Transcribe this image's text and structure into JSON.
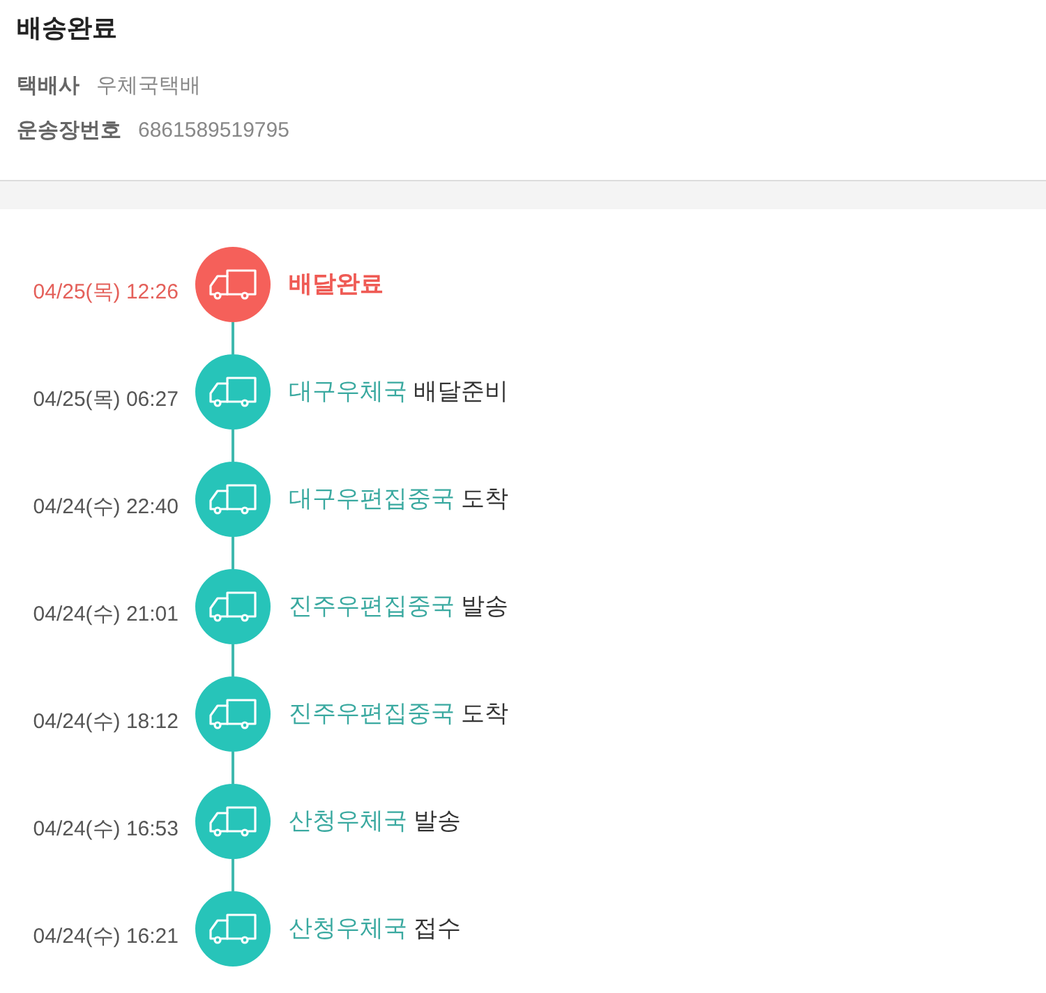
{
  "header": {
    "title": "배송완료",
    "fields": [
      {
        "label": "택배사",
        "value": "우체국택배"
      },
      {
        "label": "운송장번호",
        "value": "6861589519795"
      }
    ]
  },
  "timeline": [
    {
      "time": "04/25(목) 12:26",
      "action": "배달완료",
      "current": true
    },
    {
      "time": "04/25(목) 06:27",
      "location": "대구우체국",
      "action": "배달준비",
      "current": false
    },
    {
      "time": "04/24(수) 22:40",
      "location": "대구우편집중국",
      "action": "도착",
      "current": false
    },
    {
      "time": "04/24(수) 21:01",
      "location": "진주우편집중국",
      "action": "발송",
      "current": false
    },
    {
      "time": "04/24(수) 18:12",
      "location": "진주우편집중국",
      "action": "도착",
      "current": false
    },
    {
      "time": "04/24(수) 16:53",
      "location": "산청우체국",
      "action": "발송",
      "current": false
    },
    {
      "time": "04/24(수) 16:21",
      "location": "산청우체국",
      "action": "접수",
      "current": false
    }
  ]
}
